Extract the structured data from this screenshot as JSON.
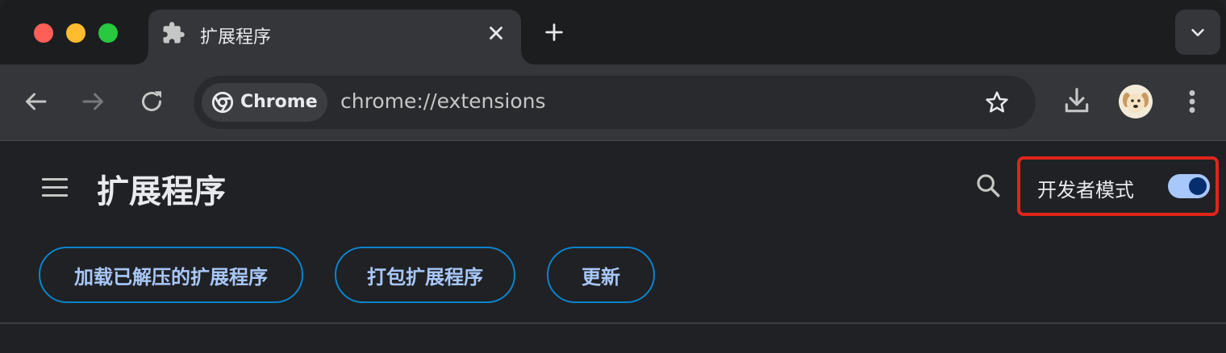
{
  "tab": {
    "title": "扩展程序"
  },
  "omnibox": {
    "chip_label": "Chrome",
    "url": "chrome://extensions"
  },
  "page": {
    "title": "扩展程序",
    "developer_mode_label": "开发者模式",
    "developer_mode_enabled": true
  },
  "actions": {
    "load_unpacked": "加载已解压的扩展程序",
    "pack": "打包扩展程序",
    "update": "更新"
  },
  "colors": {
    "accent": "#a8c7fa",
    "button_border": "#0b84cc",
    "highlight_box": "#e0251b",
    "toggle_knob": "#062e6f"
  },
  "icons": {
    "tab": "puzzle-piece-icon",
    "close": "close-icon",
    "new_tab": "plus-icon",
    "tab_search": "chevron-down-icon",
    "back": "arrow-left-icon",
    "forward": "arrow-right-icon",
    "reload": "reload-icon",
    "chip": "chrome-logo-icon",
    "bookmark": "star-icon",
    "download": "download-icon",
    "menu": "kebab-menu-icon",
    "hamburger": "hamburger-menu-icon",
    "search": "search-icon"
  }
}
